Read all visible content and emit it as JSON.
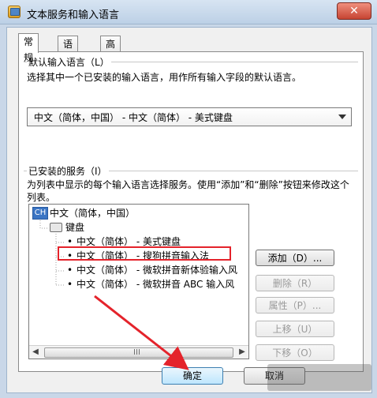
{
  "window": {
    "title": "文本服务和输入语言",
    "close_label": "✕",
    "colors": {
      "accent": "#3b75c4",
      "highlight_box": "#e4232b"
    }
  },
  "tabs": [
    {
      "label": "常规",
      "active": true
    },
    {
      "label": "语言栏",
      "active": false
    },
    {
      "label": "高级键设置",
      "active": false
    }
  ],
  "default_language": {
    "title": "默认输入语言（L）",
    "desc": "选择其中一个已安装的输入语言，用作所有输入字段的默认语言。",
    "selected": "中文（简体，中国） - 中文（简体） - 美式键盘"
  },
  "installed_services": {
    "title": "已安装的服务（I）",
    "desc": "为列表中显示的每个输入语言选择服务。使用“添加”和“删除”按钮来修改这个列表。",
    "tree": {
      "language_badge": "CH",
      "language": "中文（简体，中国）",
      "category": "键盘",
      "items": [
        "中文（简体） - 美式键盘",
        "中文（简体） - 搜狗拼音输入法",
        "中文（简体） - 微软拼音新体验输入风",
        "中文（简体） - 微软拼音 ABC 输入风"
      ]
    },
    "buttons": {
      "add": "添加（D）...",
      "remove": "删除（R）",
      "properties": "属性（P）...",
      "move_up": "上移（U）",
      "move_down": "下移（O）"
    }
  },
  "footer": {
    "ok": "确定",
    "cancel": "取消"
  }
}
